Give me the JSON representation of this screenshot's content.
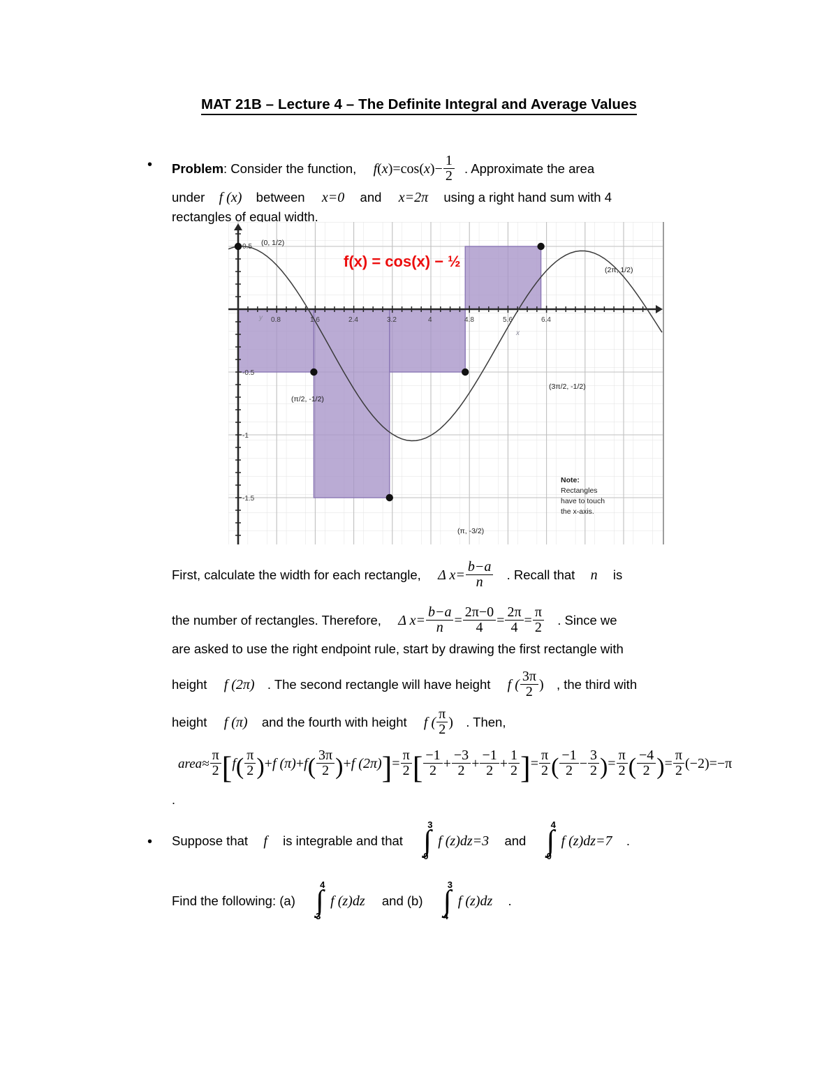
{
  "document": {
    "title": "MAT 21B – Lecture 4 – The Definite Integral and Average Values"
  },
  "problem": {
    "bullet": "•",
    "label": "Problem",
    "lead": ": Consider the function,",
    "fn_f": "f",
    "fn_paren_open": "(",
    "fn_var": "x",
    "fn_paren_close": ")",
    "fn_equals": "=cos",
    "fn_cos_open": "(",
    "fn_cos_close": ")",
    "fn_minus": "−",
    "fn_frac_num": "1",
    "fn_frac_den": "2",
    "after_fn": ". Approximate the area",
    "line2_a": "under",
    "line2_f": "f (x)",
    "line2_b": "between",
    "line2_x0": "x=0",
    "line2_c": "and",
    "line2_x2pi": "x=2π",
    "line2_d": "using a right hand sum with 4",
    "line3": "rectangles of equal width."
  },
  "graph": {
    "function_label": "f(x) = cos(x) − ½",
    "note": {
      "heading": "Note:",
      "line1": "Rectangles",
      "line2": "have to touch",
      "line3": "the x-axis."
    },
    "axis_label_x": "x",
    "axis_label_y": "y",
    "point_labels": [
      "(0, 1/2)",
      "(π/2, -1/2)",
      "(π, -3/2)",
      "(3π/2, -1/2)",
      "(2π, 1/2)"
    ],
    "colors": {
      "rect_fill": "#a794c8",
      "rect_stroke": "#8b77b5",
      "curve": "#3c3c3c",
      "grid_minor": "#d9d9d9",
      "grid_major": "#bdbdbd",
      "axis": "#2b2b2b",
      "label_red": "#ec0d0d"
    }
  },
  "chart_data": {
    "type": "line",
    "title": "f(x) = cos(x) − ½",
    "xlabel": "x",
    "ylabel": "y",
    "xlim": [
      -0.35,
      6.9
    ],
    "ylim": [
      -1.72,
      0.72
    ],
    "xticks": [
      "0.8",
      "1.6",
      "2.4",
      "3.2",
      "4",
      "4.8",
      "5.6",
      "6.4"
    ],
    "xtick_values": [
      0.8,
      1.6,
      2.4,
      3.2,
      4,
      4.8,
      5.6,
      6.4
    ],
    "yticks": [
      "0.5",
      "-0.5",
      "-1",
      "-1.5"
    ],
    "ytick_values": [
      0.5,
      -0.5,
      -1,
      -1.5
    ],
    "grid": true,
    "curve_expression": "cos(x) - 0.5",
    "curve_domain": [
      -0.35,
      6.9
    ],
    "marked_points": [
      {
        "label": "(0, 1/2)",
        "x": 0,
        "y": 0.5
      },
      {
        "label": "(π/2, -1/2)",
        "x": 1.5708,
        "y": -0.5
      },
      {
        "label": "(π, -3/2)",
        "x": 3.1416,
        "y": -1.5
      },
      {
        "label": "(3π/2, -1/2)",
        "x": 4.7124,
        "y": -0.5
      },
      {
        "label": "(2π, 1/2)",
        "x": 6.2832,
        "y": 0.5
      }
    ],
    "riemann": {
      "rule": "right endpoint",
      "n": 4,
      "dx": 1.5708,
      "rectangles": [
        {
          "x0": 0,
          "x1": 1.5708,
          "height": -0.5
        },
        {
          "x0": 1.5708,
          "x1": 3.1416,
          "height": -1.5
        },
        {
          "x0": 3.1416,
          "x1": 4.7124,
          "height": -0.5
        },
        {
          "x0": 4.7124,
          "x1": 6.2832,
          "height": 0.5
        }
      ]
    }
  },
  "body": {
    "p1_a": "First, calculate the width for each rectangle,",
    "p1_delta": "Δ x=",
    "p1_frac_num": "b−a",
    "p1_frac_den": "n",
    "p1_b": ". Recall that",
    "p1_n": "n",
    "p1_c": "is",
    "p2_a": "the number of rectangles. Therefore,",
    "p2_delta": "Δ x=",
    "p2_f1_num": "b−a",
    "p2_f1_den": "n",
    "p2_eq1": "=",
    "p2_f2_num": "2π−0",
    "p2_f2_den": "4",
    "p2_eq2": "=",
    "p2_f3_num": "2π",
    "p2_f3_den": "4",
    "p2_eq3": "=",
    "p2_f4_num": "π",
    "p2_f4_den": "2",
    "p2_b": ". Since we",
    "p3": "are asked to use the right endpoint rule, start by drawing the first rectangle with",
    "p4_a": "height",
    "p4_f2pi": "f (2π)",
    "p4_b": ". The second rectangle will have height",
    "p4_f3pi2_f": "f (",
    "p4_f3pi2_num": "3π",
    "p4_f3pi2_den": "2",
    "p4_f3pi2_close": ")",
    "p4_c": ", the third with",
    "p5_a": "height",
    "p5_fpi": "f (π)",
    "p5_b": "and the fourth with height",
    "p5_fpi2_f": "f (",
    "p5_fpi2_num": "π",
    "p5_fpi2_den": "2",
    "p5_fpi2_close": ")",
    "p5_c": ". Then,",
    "eq_area": "area≈",
    "eq_dot": "."
  },
  "equation": {
    "area_word": "area≈",
    "pi_over_2_num": "π",
    "pi_over_2_den": "2",
    "term_f_pi2": "f",
    "term_f_pi": "f (π)",
    "term_f_3pi2": "f",
    "term_f_2pi": "f (2π)",
    "v1_num": "−1",
    "v1_den": "2",
    "v2_num": "−3",
    "v2_den": "2",
    "v3_num": "−1",
    "v3_den": "2",
    "v4_num": "1",
    "v4_den": "2",
    "s1_num": "−1",
    "s1_den": "2",
    "s2_num": "3",
    "s2_den": "2",
    "r_num": "−4",
    "r_den": "2",
    "final_paren": "(−2)",
    "final_result": "=−π",
    "plus": "+",
    "minus": "−",
    "equals": "=",
    "num3pi": "3π",
    "den2": "2",
    "npi": "π",
    "num_pi": "π"
  },
  "suppose": {
    "bullet": "•",
    "a": "Suppose that",
    "f": "f",
    "b": "is integrable and that",
    "int1_upper": "3",
    "int1_lower": "0",
    "int1_body": "f (z)dz=3",
    "c": "and",
    "int2_upper": "4",
    "int2_lower": "0",
    "int2_body": "f (z)dz=7",
    "d": "."
  },
  "find": {
    "a": "Find the following: (a)",
    "int_a_upper": "4",
    "int_a_lower": "3",
    "int_a_body": "f (z)dz",
    "b": "and (b)",
    "int_b_upper": "3",
    "int_b_lower": "4",
    "int_b_body": "f (z)dz",
    "c": "."
  }
}
